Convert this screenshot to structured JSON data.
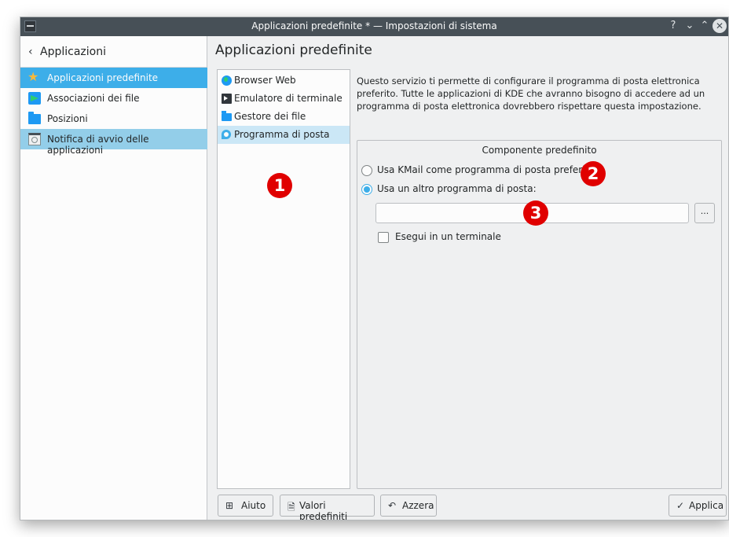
{
  "window": {
    "title": "Applicazioni predefinite * — Impostazioni di sistema",
    "controls": {
      "help": "?",
      "minimize": "⌄",
      "maximize": "⌃",
      "close": "✕"
    }
  },
  "sidebar": {
    "back_label": "Applicazioni",
    "back_icon": "‹",
    "items": [
      {
        "label": "Applicazioni predefinite",
        "icon": "star-icon",
        "state": "selected"
      },
      {
        "label": "Associazioni dei file",
        "icon": "file-association-icon",
        "state": "normal"
      },
      {
        "label": "Posizioni",
        "icon": "folder-icon",
        "state": "normal"
      },
      {
        "label": "Notifica di avvio delle applicazioni",
        "icon": "launch-feedback-icon",
        "state": "hover"
      }
    ]
  },
  "main": {
    "title": "Applicazioni predefinite",
    "components": [
      {
        "label": "Browser Web",
        "icon": "globe-icon",
        "selected": false
      },
      {
        "label": "Emulatore di terminale",
        "icon": "terminal-icon",
        "selected": false
      },
      {
        "label": "Gestore dei file",
        "icon": "file-manager-icon",
        "selected": false
      },
      {
        "label": "Programma di posta",
        "icon": "mail-client-icon",
        "selected": true
      }
    ],
    "description": "Questo servizio ti permette di configurare il programma di posta elettronica preferito. Tutte le applicazioni di KDE che avranno bisogno di accedere ad un programma di posta elettronica dovrebbero rispettare questa impostazione.",
    "group_title": "Componente predefinito",
    "option_kmail": "Usa KMail come programma di posta preferito",
    "option_other": "Usa un altro programma di posta:",
    "selected_option": "other",
    "command_value": "",
    "browse_label": "...",
    "run_in_terminal_label": "Esegui in un terminale",
    "run_in_terminal_checked": false
  },
  "annotations": [
    "1",
    "2",
    "3"
  ],
  "footer": {
    "help_label": "Aiuto",
    "defaults_label": "Valori predefiniti",
    "reset_label": "Azzera",
    "apply_label": "Applica"
  },
  "colors": {
    "accent": "#3daee9",
    "selection_hover": "#93cee9",
    "titlebar": "#475057",
    "annotation_badge": "#e00000"
  }
}
